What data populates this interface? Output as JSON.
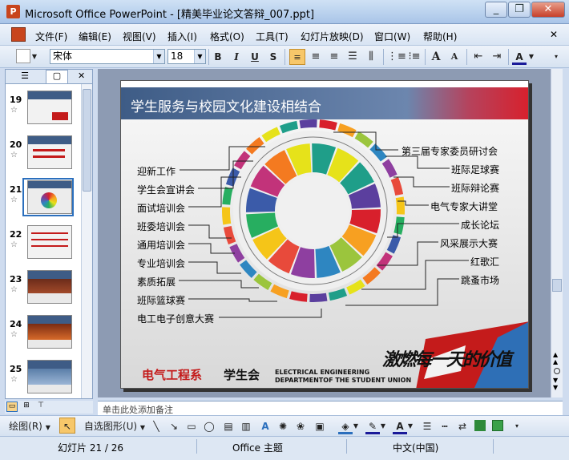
{
  "window": {
    "title": "Microsoft Office PowerPoint - [精美毕业论文答辩_007.ppt]",
    "app_icon": "P"
  },
  "window_buttons": {
    "minimize": "_",
    "restore": "❐",
    "close": "✕"
  },
  "menubar": [
    "文件(F)",
    "编辑(E)",
    "视图(V)",
    "插入(I)",
    "格式(O)",
    "工具(T)",
    "幻灯片放映(D)",
    "窗口(W)",
    "帮助(H)"
  ],
  "menubar_close": "✕",
  "formatting": {
    "font": "宋体",
    "size": "18",
    "bold": "B",
    "italic": "I",
    "underline": "U",
    "shadow": "S",
    "grow": "A",
    "shrink": "A"
  },
  "thumbnails": [
    {
      "num": "19",
      "star": "☆"
    },
    {
      "num": "20",
      "star": "☆"
    },
    {
      "num": "21",
      "star": "☆"
    },
    {
      "num": "22",
      "star": "☆"
    },
    {
      "num": "23",
      "star": "☆"
    },
    {
      "num": "24",
      "star": "☆"
    },
    {
      "num": "25",
      "star": "☆"
    }
  ],
  "slide": {
    "title": "学生服务与校园文化建设相结合",
    "left_labels": [
      "迎新工作",
      "学生会宣讲会",
      "面试培训会",
      "班委培训会",
      "通用培训会",
      "专业培训会",
      "素质拓展",
      "班际篮球赛",
      "电工电子创意大赛"
    ],
    "right_labels": [
      "第三届专家委员研讨会",
      "班际足球赛",
      "班际辩论赛",
      "电气专家大讲堂",
      "成长论坛",
      "风采展示大赛",
      "红歌汇",
      "跳蚤市场"
    ],
    "footer_cn_red": "电气工程系",
    "footer_cn_black": "学生会",
    "footer_en_line1": "ELECTRICAL ENGINEERING",
    "footer_en_line2": "DEPARTMENTOF THE STUDENT UNION",
    "calligraphy": "激燃每一天的价值"
  },
  "notes": {
    "placeholder": "单击此处添加备注"
  },
  "drawbar": {
    "draw": "绘图(R)",
    "autoshape": "自选图形(U)"
  },
  "statusbar": {
    "slide": "幻灯片 21 / 26",
    "theme": "Office 主题",
    "language": "中文(中国)"
  },
  "colors": {
    "accent": "#d8202c",
    "header_blue": "#3e5c86"
  }
}
